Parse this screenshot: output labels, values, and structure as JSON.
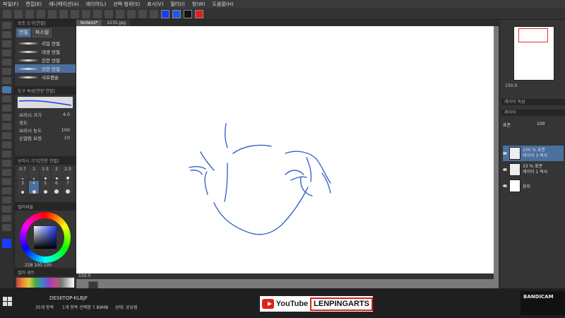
{
  "menu": [
    "파일(F)",
    "편집(E)",
    "애니메이션(A)",
    "레이어(L)",
    "선택 범위(S)",
    "표시(V)",
    "필터(I)",
    "창(W)",
    "도움말(H)"
  ],
  "colors": {
    "main": "#1a3cff",
    "sub": "#2255ee",
    "swatch3": "#111111",
    "swatch4": "#e02020",
    "accent": "#4b6f9e",
    "stroke": "#3a63c9"
  },
  "tabs": [
    "lenlenz*",
    "2235.jpg"
  ],
  "sub_tool": {
    "header": "보조 도구[연필]",
    "tab1": "연필",
    "tab2": "파스텔",
    "brushes": [
      "리얼 연필",
      "대생 연필",
      "진한 연필",
      "연한 연필",
      "샤프펜슬"
    ],
    "selected_index": 3
  },
  "tool_prop": {
    "header": "도구 속성[연한 연필]",
    "rows": [
      {
        "label": "브러시 크기",
        "value": "4.0"
      },
      {
        "label": "경도",
        "value": ""
      },
      {
        "label": "브러시 농도",
        "value": "100"
      },
      {
        "label": "손떨림 보정",
        "value": "10"
      }
    ]
  },
  "brush_size": {
    "header": "브러시 크기[연한 연필]",
    "sizes": [
      "0.7",
      "1",
      "1.5",
      "2",
      "2.5",
      "3",
      "4",
      "5",
      "6",
      "7"
    ],
    "selected": "4"
  },
  "color_wheel": {
    "header": "컬러써클",
    "readout": "228 100 100"
  },
  "color_set": {
    "header": "컬러 세트"
  },
  "status": {
    "zoom": "150.0"
  },
  "navigator": {
    "zoom": "150.0"
  },
  "layer_prop_header": "레이어 속성",
  "layers_header": "레이어",
  "layer_blend": "표준",
  "layer_opacity": "100",
  "layers": [
    {
      "pct": "100 % 표준",
      "name": "레이어 3 복사"
    },
    {
      "pct": "33 % 표준",
      "name": "레이어 1 복사"
    },
    {
      "pct": "",
      "name": "용지"
    }
  ],
  "taskbar": {
    "pc": "DESKTOP-KLBJF",
    "items": "35개 항목",
    "selected": "1개 항목 선택함 7.89MB",
    "state": "상태: 공유됨"
  },
  "youtube": {
    "word": "YouTube",
    "channel": "LENPINGARTS"
  },
  "bandicam": "BANDICAM"
}
